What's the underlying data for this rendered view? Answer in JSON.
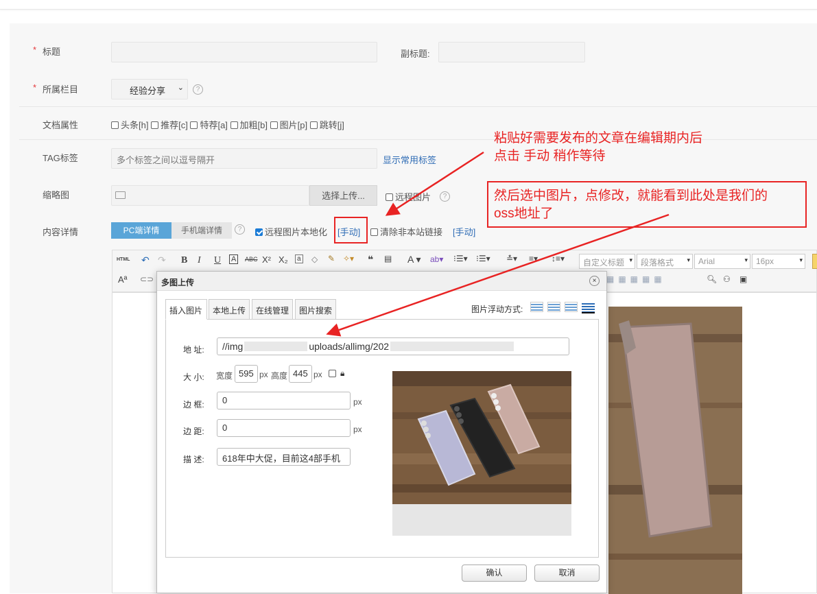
{
  "form": {
    "title_label": "标题",
    "subtitle_label": "副标题:",
    "column_label": "所属栏目",
    "column_value": "经验分享",
    "doc_attr_label": "文档属性",
    "attrs": [
      "头条[h]",
      "推荐[c]",
      "特荐[a]",
      "加粗[b]",
      "图片[p]",
      "跳转[j]"
    ],
    "tag_label": "TAG标签",
    "tag_placeholder": "多个标签之间以逗号隔开",
    "tag_link": "显示常用标签",
    "thumb_label": "缩略图",
    "upload_button": "选择上传...",
    "remote_image": "远程图片",
    "content_label": "内容详情",
    "tab_pc": "PC端详情",
    "tab_mobile": "手机端详情",
    "localize_label": "远程图片本地化",
    "manual_link": "[手动]",
    "clear_links_label": "清除非本站链接",
    "help": "?"
  },
  "toolbar": {
    "html": "HTML",
    "heading_select": "自定义标题",
    "paragraph_select": "段落格式",
    "font_select": "Arial",
    "size_select": "16px"
  },
  "dialog": {
    "title": "多图上传",
    "close": "×",
    "tabs": [
      "插入图片",
      "本地上传",
      "在线管理",
      "图片搜索"
    ],
    "float_label": "图片浮动方式:",
    "addr_label": "地 址:",
    "addr_part1": "//img",
    "addr_part2": "uploads/allimg/202",
    "size_label": "大 小:",
    "width_label": "宽度",
    "width_value": "595",
    "px": "px",
    "height_label": "高度",
    "height_value": "445",
    "border_label": "边 框:",
    "border_value": "0",
    "margin_label": "边 距:",
    "margin_value": "0",
    "desc_label": "描 述:",
    "desc_value": "618年中大促，目前这4部手机",
    "ok": "确认",
    "cancel": "取消"
  },
  "annotations": {
    "note1_line1": "粘贴好需要发布的文章在编辑期内后",
    "note1_line2": "点击  手动  稍作等待",
    "note2_line1": "然后选中图片，点修改，就能看到此处是我们的",
    "note2_line2": "oss地址了"
  },
  "colors": {
    "annotation": "#e82323",
    "accent_tab": "#5aa5d8",
    "link": "#2f6cb5"
  }
}
